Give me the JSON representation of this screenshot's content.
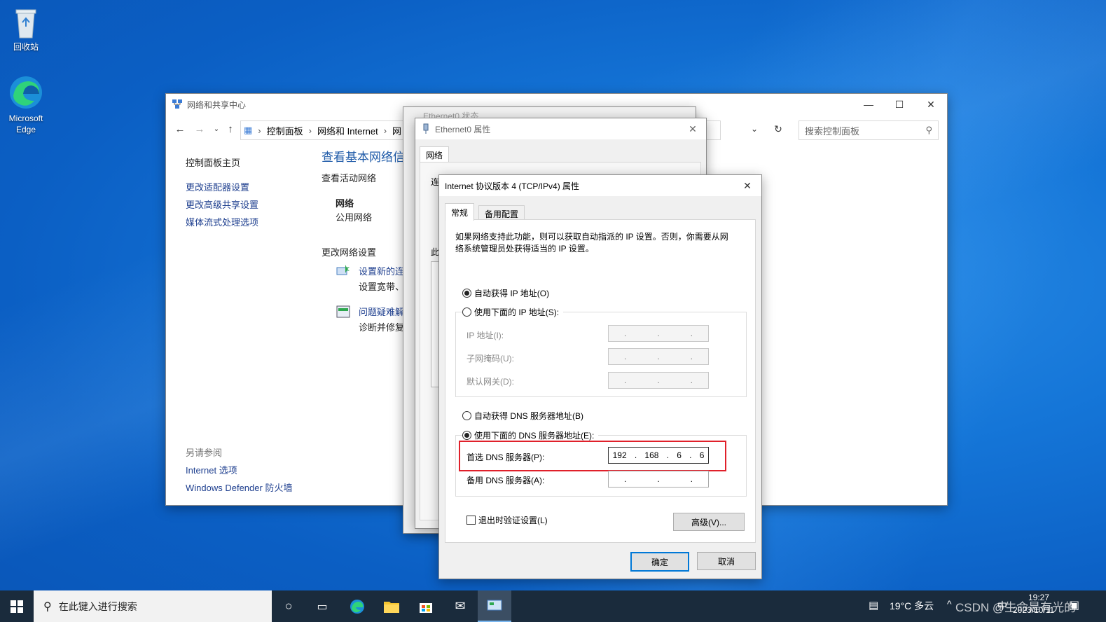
{
  "desktop": {
    "icons": [
      {
        "label": "回收站",
        "icon": "recycle-bin-icon"
      },
      {
        "label": "Microsoft Edge",
        "icon": "edge-icon"
      }
    ]
  },
  "control_panel": {
    "title": "网络和共享中心",
    "breadcrumb": [
      "控制面板",
      "网络和 Internet",
      "网"
    ],
    "search_placeholder": "搜索控制面板",
    "sidebar": {
      "home": "控制面板主页",
      "links": [
        "更改适配器设置",
        "更改高级共享设置",
        "媒体流式处理选项"
      ],
      "see_also_title": "另请参阅",
      "see_also": [
        "Internet 选项",
        "Windows Defender 防火墙"
      ]
    },
    "main": {
      "heading": "查看基本网络信息",
      "active_networks": "查看活动网络",
      "network_name": "网络",
      "network_type": "公用网络",
      "change_settings": "更改网络设置",
      "setup_new_link": "设置新的连",
      "setup_new_desc": "设置宽带、拨",
      "troubleshoot_link": "问题疑难解答",
      "troubleshoot_desc": "诊断并修复问"
    }
  },
  "eth_status": {
    "title": "Ethernet0 状态"
  },
  "eth_props": {
    "title": "Ethernet0 属性",
    "tab": "网络",
    "frag1": "连",
    "frag2": "此"
  },
  "tcp_dialog": {
    "title": "Internet 协议版本 4 (TCP/IPv4) 属性",
    "tabs": [
      "常规",
      "备用配置"
    ],
    "description": "如果网络支持此功能，则可以获取自动指派的 IP 设置。否则，你需要从网络系统管理员处获得适当的 IP 设置。",
    "auto_ip": "自动获得 IP 地址(O)",
    "manual_ip": "使用下面的 IP 地址(S):",
    "ip_label": "IP 地址(I):",
    "mask_label": "子网掩码(U):",
    "gateway_label": "默认网关(D):",
    "auto_dns": "自动获得 DNS 服务器地址(B)",
    "manual_dns": "使用下面的 DNS 服务器地址(E):",
    "preferred_dns_label": "首选 DNS 服务器(P):",
    "preferred_dns": [
      "192",
      "168",
      "6",
      "6"
    ],
    "alternate_dns_label": "备用 DNS 服务器(A):",
    "validate_label": "退出时验证设置(L)",
    "advanced": "高级(V)...",
    "ok": "确定",
    "cancel": "取消",
    "selected_ip_mode": "auto",
    "selected_dns_mode": "manual",
    "highlight_color": "#e0202a"
  },
  "taskbar": {
    "search_placeholder": "在此键入进行搜索",
    "weather": "19°C 多云",
    "time": "19:27",
    "date": "2023/10/11",
    "watermark": "CSDN @生命是有光的",
    "lang": "中"
  }
}
